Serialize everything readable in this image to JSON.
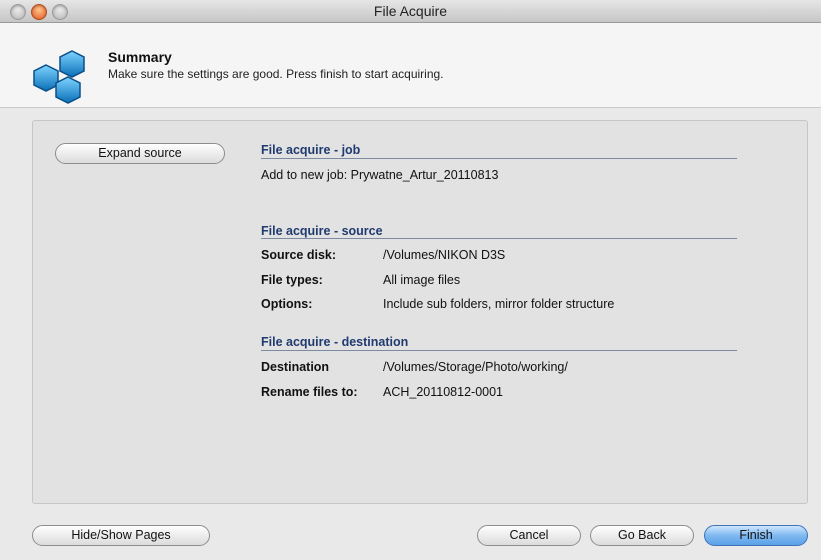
{
  "window": {
    "title": "File Acquire"
  },
  "header": {
    "title": "Summary",
    "subtitle": "Make sure the settings are good. Press finish to start acquiring.",
    "logo_icon": "hexagon-cluster-icon"
  },
  "panel": {
    "expand_button": "Expand source",
    "job_section": {
      "title": "File acquire - job",
      "line": "Add to new job: Prywatne_Artur_20110813"
    },
    "source_section": {
      "title": "File acquire - source",
      "rows": [
        {
          "label": "Source disk:",
          "value": "/Volumes/NIKON D3S"
        },
        {
          "label": "File types:",
          "value": "All image files"
        },
        {
          "label": "Options:",
          "value": "Include sub folders, mirror folder structure"
        }
      ]
    },
    "destination_section": {
      "title": "File acquire - destination",
      "rows": [
        {
          "label": "Destination",
          "value": "/Volumes/Storage/Photo/working/"
        },
        {
          "label": "Rename files to:",
          "value": "ACH_20110812-0001"
        }
      ]
    }
  },
  "footer": {
    "hide_show_button": "Hide/Show Pages",
    "cancel_button": "Cancel",
    "back_button": "Go Back",
    "finish_button": "Finish"
  },
  "colors": {
    "section_title": "#203b70",
    "primary_button": "#5aa0e8",
    "logo_blue": "#1b8fd0"
  }
}
